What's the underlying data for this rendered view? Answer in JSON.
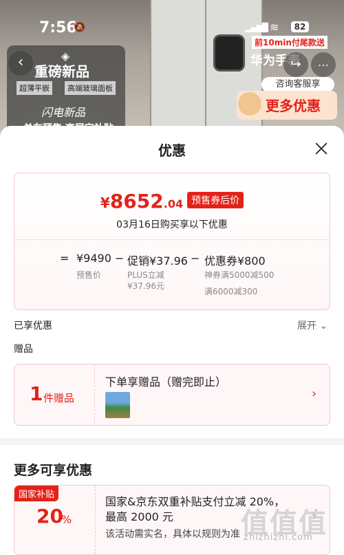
{
  "status_bar": {
    "time": "7:56",
    "battery": "82"
  },
  "background_page": {
    "promo_title": "重磅新品",
    "tag_1": "超薄平嵌",
    "tag_2": "高端玻璃面板",
    "flash_text": "闪电新品",
    "bottom_text": "单车预售 高层定补贴",
    "ad_line_1": "前10min付尾款送",
    "ad_line_2": "华为手表",
    "service_label": "咨询客服享",
    "more_deals_label": "更多优惠"
  },
  "sheet": {
    "title": "优惠",
    "price": {
      "currency": "¥",
      "integer": "8652",
      "decimal": ".04",
      "badge": "预售券后价"
    },
    "date_text": "03月16日购买享以下优惠",
    "calc": {
      "eq": "=",
      "presale_price": "¥9490",
      "presale_label": "预售价",
      "minus_1": "−",
      "promo": "促销¥37.96",
      "promo_sub_1": "PLUS立减",
      "promo_sub_2": "¥37.96元",
      "minus_2": "−",
      "coupon": "优惠券¥800",
      "coupon_sub_1": "神券满5000减500",
      "coupon_sub_2": "满6000减300"
    },
    "enjoyed_label": "已享优惠",
    "expand_label": "展开",
    "gifts_label": "赠品",
    "gift": {
      "count": "1",
      "unit": "件赠品",
      "title": "下单享赠品（赠完即止）"
    },
    "more_title": "更多可享优惠",
    "subsidy": {
      "tag": "国家补贴",
      "percent": "20",
      "percent_sign": "%",
      "line_1": "国家&京东双重补贴支付立减 20%，",
      "line_2": "最高 2000 元",
      "line_3": "该活动需实名，具体以规则为准"
    }
  },
  "watermark": {
    "mark": "值值值",
    "text": "zhizhizhi.com"
  }
}
